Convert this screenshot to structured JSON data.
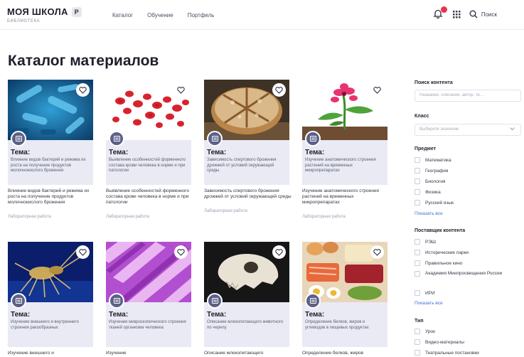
{
  "header": {
    "logo_title": "МОЯ ШКОЛА",
    "logo_badge": "Р",
    "logo_subtitle": "БИБЛИОТЕКА",
    "nav": [
      "Каталог",
      "Обучение",
      "Портфель"
    ],
    "search_label": "Поиск",
    "icons": [
      "bell-icon",
      "grid-icon",
      "search-icon"
    ]
  },
  "page": {
    "title": "Каталог материалов"
  },
  "cards": [
    {
      "label": "Тема:",
      "panel_text": "Влияние видов бактерий и режима их роста на получение продуктов молочнокислого брожения",
      "description": "Влияние видов бактерий и режима их роста на получение продуктов молочнокислого брожения",
      "meta": "Лабораторная работа",
      "image": "bacteria"
    },
    {
      "label": "Тема:",
      "panel_text": "Выявление особенностей форменного состава крови человека в норме и при патологии",
      "description": "Выявление особенностей форменного состава крови человека в норме и при патологии",
      "meta": "Лабораторная работа",
      "image": "blood-cells"
    },
    {
      "label": "Тема:",
      "panel_text": "Зависимость спиртового брожения дрожжей от условий окружающей среды",
      "description": "Зависимость спиртового брожения дрожжей от условий окружающей среды",
      "meta": "Лабораторная работа",
      "image": "bread"
    },
    {
      "label": "Тема:",
      "panel_text": "Изучение анатомического строения растений на временных микропрепаратах",
      "description": "Изучение анатомического строения растений на временных микропрепаратах",
      "meta": "Лабораторная работа",
      "image": "flower"
    },
    {
      "label": "Тема:",
      "panel_text": "Изучение внешнего и внутреннего строения ракообразных",
      "description": "Изучение внешнего и",
      "meta": "",
      "image": "crustacean"
    },
    {
      "label": "Тема:",
      "panel_text": "Изучение микроскопического строения тканей организма человека",
      "description": "Изучение",
      "meta": "",
      "image": "tissue"
    },
    {
      "label": "Тема:",
      "panel_text": "Описание млекопитающего животного по черепу",
      "description": "Описание млекопитающего",
      "meta": "",
      "image": "skull"
    },
    {
      "label": "Тема:",
      "panel_text": "Определение белков, жиров и углеводов в пищевых продуктах",
      "description": "Определение белков, жиров",
      "meta": "",
      "image": "food"
    }
  ],
  "filters": {
    "search": {
      "label": "Поиск контента",
      "placeholder": "Название, описание, автор, те..."
    },
    "class": {
      "label": "Класс",
      "placeholder": "Выберите значение"
    },
    "subject": {
      "label": "Предмет",
      "items": [
        "Математика",
        "География",
        "Биология",
        "Физика",
        "Русский язык"
      ],
      "show_all": "Показать все"
    },
    "provider": {
      "label": "Поставщик контента",
      "items": [
        "РЭШ",
        "Исторические парки",
        "Правильное кино",
        "Академия Минпросвещения России",
        "ИРИ"
      ],
      "show_all": "Показать все"
    },
    "type": {
      "label": "Тип",
      "items": [
        "Урок",
        "Видео-материалы",
        "Театральные постановки"
      ]
    }
  },
  "colors": {
    "accent": "#3b6fd8",
    "panel": "#e9eaf4",
    "type_icon": "#5c6188",
    "badge": "#e8334a"
  }
}
